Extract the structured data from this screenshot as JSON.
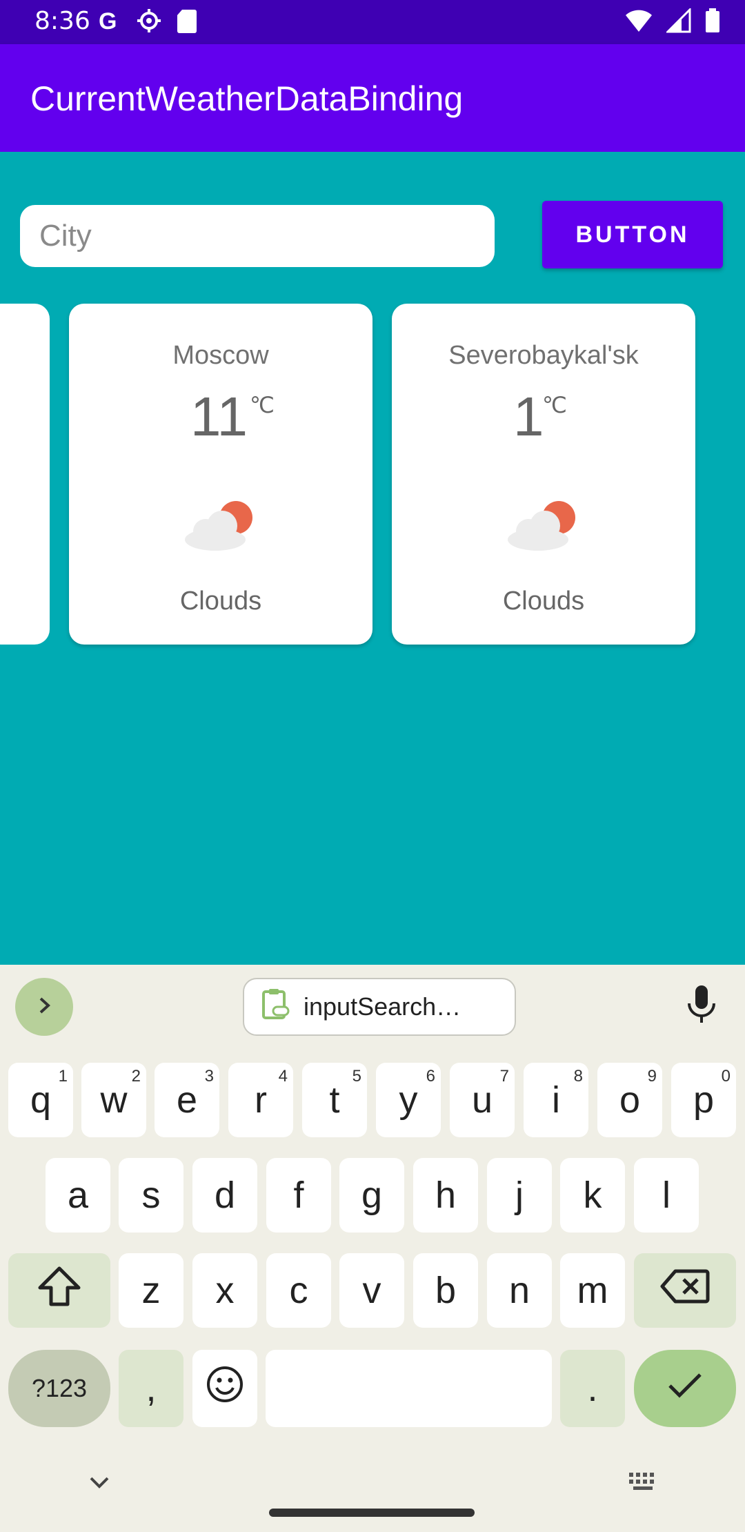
{
  "status_bar": {
    "time": "8:36",
    "left_icons": [
      "google-g-icon",
      "settings-gear-icon",
      "sd-card-icon"
    ],
    "right_icons": [
      "wifi-icon",
      "signal-icon",
      "battery-icon"
    ]
  },
  "app_bar": {
    "title": "CurrentWeatherDataBinding"
  },
  "search": {
    "placeholder": "City",
    "value": "",
    "button_label": "BUTTON"
  },
  "cards": [
    {
      "city": "Moscow",
      "temp": "11",
      "unit": "℃",
      "icon": "clouds-sun-icon",
      "description": "Clouds"
    },
    {
      "city": "Severobaykal'sk",
      "temp": "1",
      "unit": "℃",
      "icon": "clouds-sun-icon",
      "description": "Clouds"
    }
  ],
  "keyboard": {
    "clipboard_chip": "inputSearch…",
    "row1": [
      {
        "k": "q",
        "s": "1"
      },
      {
        "k": "w",
        "s": "2"
      },
      {
        "k": "e",
        "s": "3"
      },
      {
        "k": "r",
        "s": "4"
      },
      {
        "k": "t",
        "s": "5"
      },
      {
        "k": "y",
        "s": "6"
      },
      {
        "k": "u",
        "s": "7"
      },
      {
        "k": "i",
        "s": "8"
      },
      {
        "k": "o",
        "s": "9"
      },
      {
        "k": "p",
        "s": "0"
      }
    ],
    "row2": [
      "a",
      "s",
      "d",
      "f",
      "g",
      "h",
      "j",
      "k",
      "l"
    ],
    "row3": [
      "z",
      "x",
      "c",
      "v",
      "b",
      "n",
      "m"
    ],
    "sym_label": "?123",
    "comma": ",",
    "period": "."
  },
  "colors": {
    "status_bar": "#3f00b3",
    "app_bar": "#6200ee",
    "background": "#00abb3",
    "button": "#6200ee",
    "enter_key": "#a8cf8d"
  }
}
